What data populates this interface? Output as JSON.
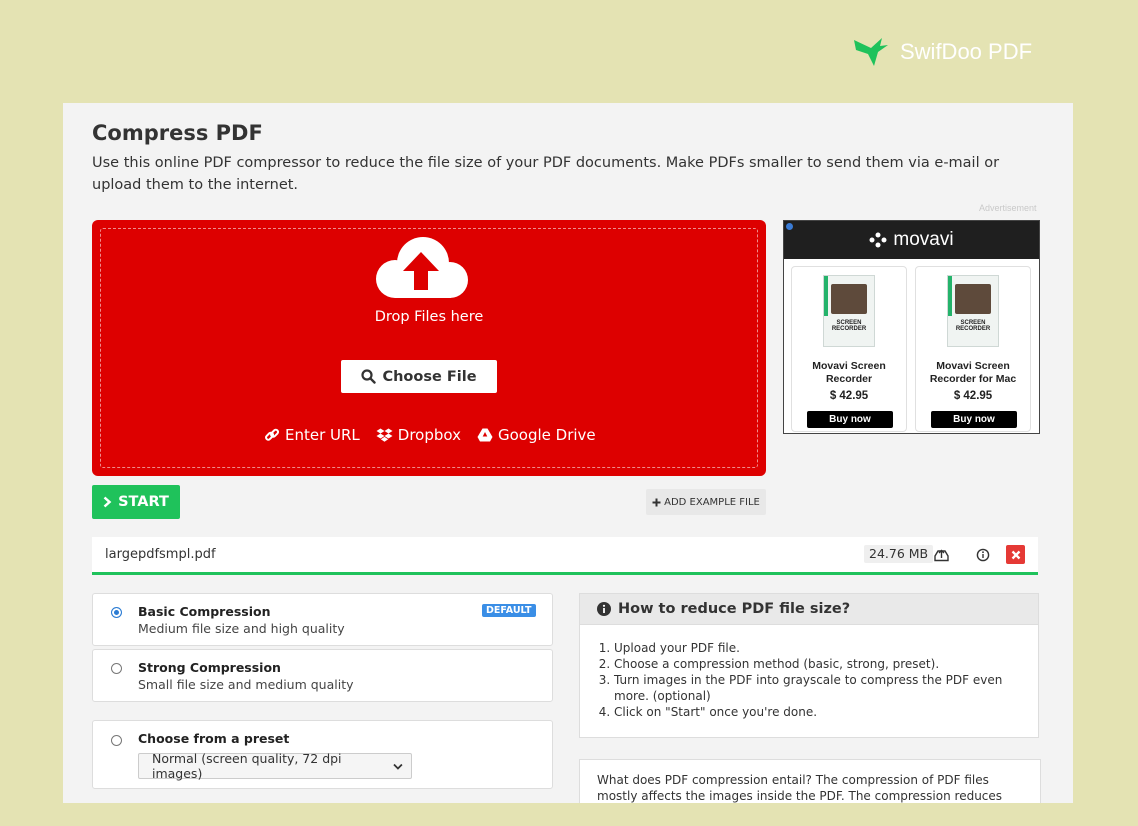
{
  "brand": {
    "name": "SwifDoo PDF"
  },
  "page": {
    "title": "Compress PDF",
    "description": "Use this online PDF compressor to reduce the file size of your PDF documents. Make PDFs smaller to send them via e-mail or upload them to the internet.",
    "ad_label": "Advertisement"
  },
  "upload": {
    "drop_text": "Drop Files here",
    "choose_label": "Choose File",
    "sources": [
      "Enter URL",
      "Dropbox",
      "Google Drive"
    ]
  },
  "ad": {
    "brand": "movavi",
    "products": [
      {
        "name": "Movavi Screen Recorder",
        "price": "$ 42.95",
        "cta": "Buy now",
        "box_label": "SCREEN RECORDER"
      },
      {
        "name": "Movavi Screen Recorder for Mac",
        "price": "$ 42.95",
        "cta": "Buy now",
        "box_label": "SCREEN RECORDER"
      }
    ]
  },
  "actions": {
    "start_label": "START",
    "add_example_label": "ADD EXAMPLE FILE"
  },
  "file": {
    "name": "largepdfsmpl.pdf",
    "size": "24.76 MB"
  },
  "options": [
    {
      "title": "Basic Compression",
      "subtitle": "Medium file size and high quality",
      "badge": "DEFAULT",
      "selected": true
    },
    {
      "title": "Strong Compression",
      "subtitle": "Small file size and medium quality",
      "selected": false
    },
    {
      "title": "Choose from a preset",
      "selected": false,
      "preset_value": "Normal (screen quality, 72 dpi images)"
    }
  ],
  "howto": {
    "title": "How to reduce PDF file size?",
    "steps": [
      "Upload your PDF file.",
      "Choose a compression method (basic, strong, preset).",
      "Turn images in the PDF into grayscale to compress the PDF even more. (optional)",
      "Click on \"Start\" once you're done."
    ]
  },
  "info": {
    "text": "What does PDF compression entail? The compression of PDF files mostly affects the images inside the PDF. The compression reduces the quality of"
  },
  "colors": {
    "background": "#e4e3b3",
    "upload_red": "#dd0000",
    "start_green": "#1fc25b",
    "close_red": "#e53935",
    "badge_blue": "#3a8ee6"
  }
}
